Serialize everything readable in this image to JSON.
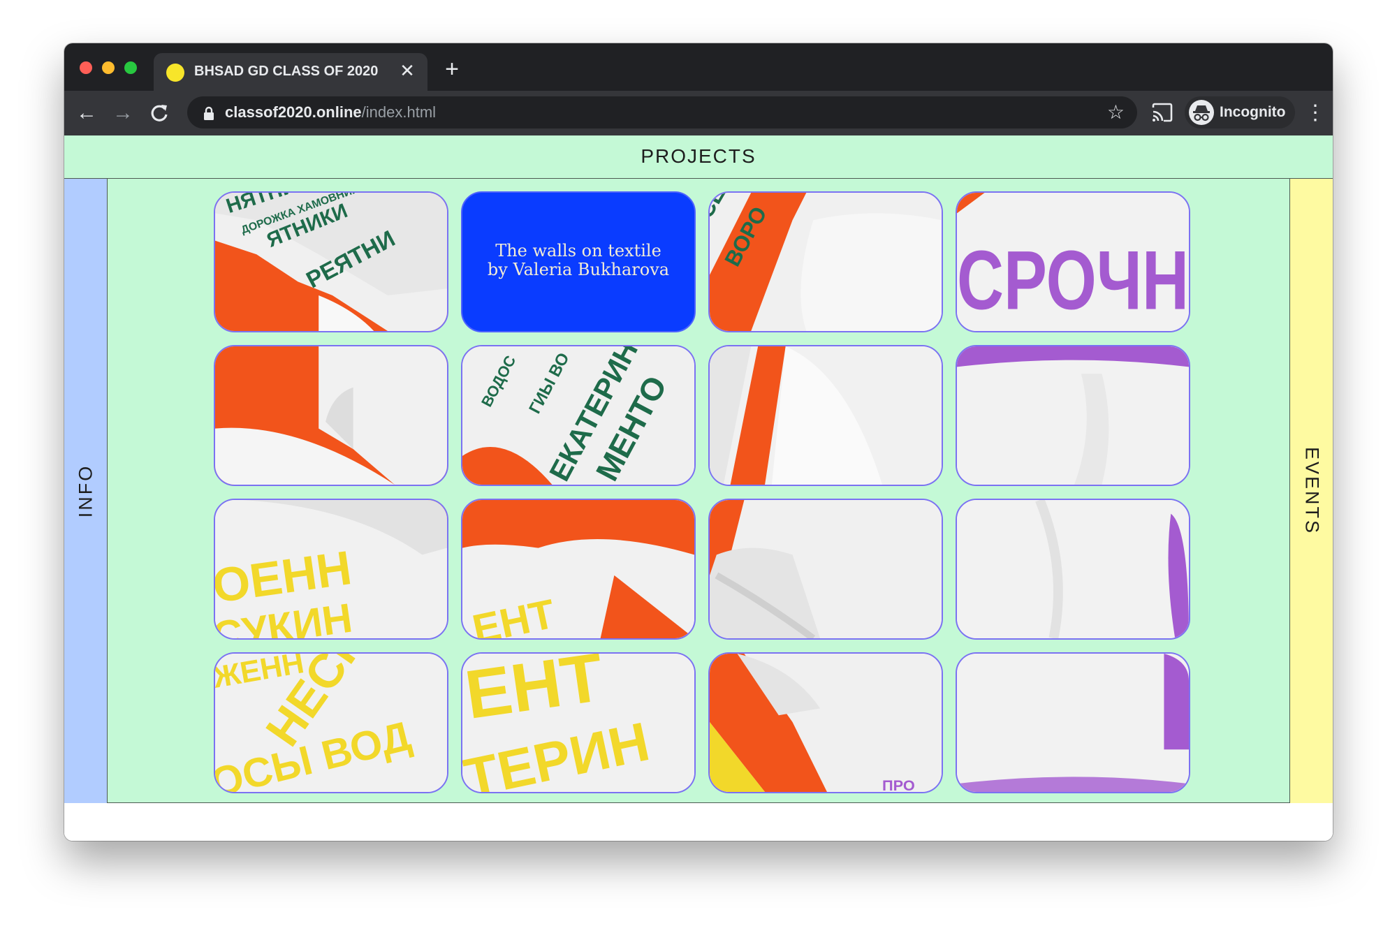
{
  "browser": {
    "tab": {
      "title": "BHSAD GD CLASS OF 2020",
      "favicon": "yellow-circle-favicon",
      "close_icon": "close-icon"
    },
    "new_tab_icon": "plus-icon",
    "toolbar": {
      "back_icon": "arrow-left-icon",
      "forward_icon": "arrow-right-icon",
      "reload_icon": "reload-icon",
      "url_host": "classof2020.online",
      "url_path": "/index.html",
      "lock_icon": "lock-icon",
      "bookmark_icon": "star-icon",
      "cast_icon": "cast-icon",
      "profile_label": "Incognito",
      "profile_icon": "incognito-icon",
      "menu_icon": "kebab-menu-icon"
    }
  },
  "page": {
    "header": {
      "label": "PROJECTS",
      "color": "#c4f9d6"
    },
    "left_sidebar": {
      "label": "INFO",
      "color": "#b1ccff"
    },
    "right_sidebar": {
      "label": "EVENTS",
      "color": "#fefaa1"
    },
    "project_caption": {
      "line1": "The walls on textile",
      "line2": "by Valeria Bukharova",
      "color": "#0a3cff"
    },
    "tile_image": "white t-shirts printed with cyrillic lettering in green, purple and yellow on an orange background, sliced into a 4x4 grid",
    "accent_colors": {
      "orange": "#f2541b",
      "green_text": "#1e6b4a",
      "purple_text": "#a45bd0",
      "yellow_text": "#f2d82a",
      "tile_border": "#7b72f2"
    }
  }
}
